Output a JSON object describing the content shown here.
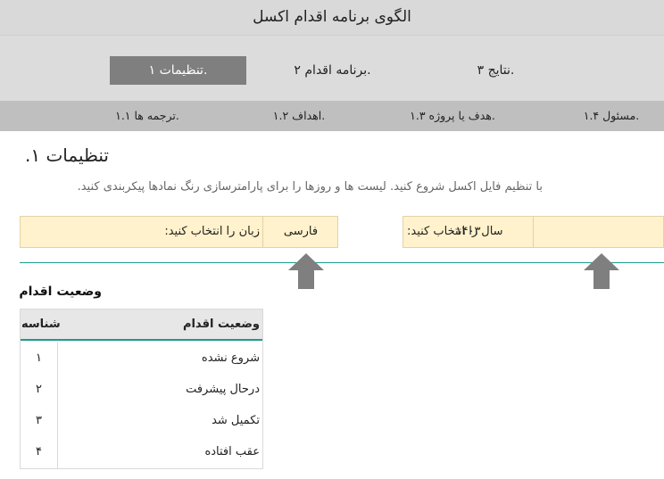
{
  "app_title": "الگوی برنامه اقدام اکسل",
  "main_tabs": [
    {
      "label": "تنظیمات ۱.",
      "active": true
    },
    {
      "label": "برنامه اقدام ۲.",
      "active": false
    },
    {
      "label": "نتایج ۳.",
      "active": false
    }
  ],
  "sub_tabs": [
    {
      "label": "ترجمه ها ۱.۱."
    },
    {
      "label": "اهداف ۱.۲."
    },
    {
      "label": "هدف  یا پروژه ۱.۳."
    },
    {
      "label": "مسئول ۱.۴."
    }
  ],
  "page": {
    "title": "تنظیمات ۱.",
    "intro": "با تنظیم فایل اکسل شروع کنید. لیست ها و روزها را برای پارامترسازی رنگ نمادها پیکربندی کنید."
  },
  "settings": {
    "language_label": "زبان را انتخاب کنید:",
    "language_value": "فارسی",
    "year_label": "سال را انتخاب کنید:",
    "year_value": "۱۴۰۳"
  },
  "status": {
    "heading": "وضعیت اقدام",
    "col_name": "وضعیت اقدام",
    "col_id": "شناسه",
    "rows": [
      {
        "name": "شروع نشده",
        "id": "۱"
      },
      {
        "name": "درحال پیشرفت",
        "id": "۲"
      },
      {
        "name": "تکمیل شد",
        "id": "۳"
      },
      {
        "name": "عقب افتاده",
        "id": "۴"
      }
    ]
  },
  "colors": {
    "accent_teal": "#1a9c8c",
    "active_tab": "#7f7f7f",
    "settings_fill": "#fff2cc",
    "arrow": "#7f7f7f"
  },
  "icons": [
    "up-arrow-icon"
  ]
}
